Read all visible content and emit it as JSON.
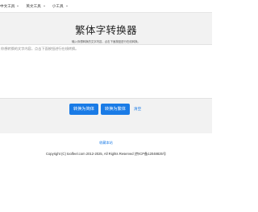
{
  "nav": {
    "items": [
      {
        "label": "中文工具"
      },
      {
        "label": "英文工具"
      },
      {
        "label": "小工具"
      }
    ]
  },
  "header": {
    "title": "繁体字转换器",
    "subtitle": "输入你想转换的文字内容，点击下面按钮进行在线转换。"
  },
  "editor": {
    "placeholder": "你想转换的文字内容，点击下面按钮进行在线转换。",
    "value": ""
  },
  "actions": {
    "to_simplified": "转换为简体",
    "to_traditional": "转换为繁体",
    "clear": "清空"
  },
  "footer": {
    "bookmark": "收藏本站",
    "copyright": "Copyright (C) toolfeel.com 2012-2025, All Rights Reserved |京ICP备12048825号"
  },
  "colors": {
    "accent": "#1a7be6",
    "panel_bg": "#f2f2f2"
  }
}
